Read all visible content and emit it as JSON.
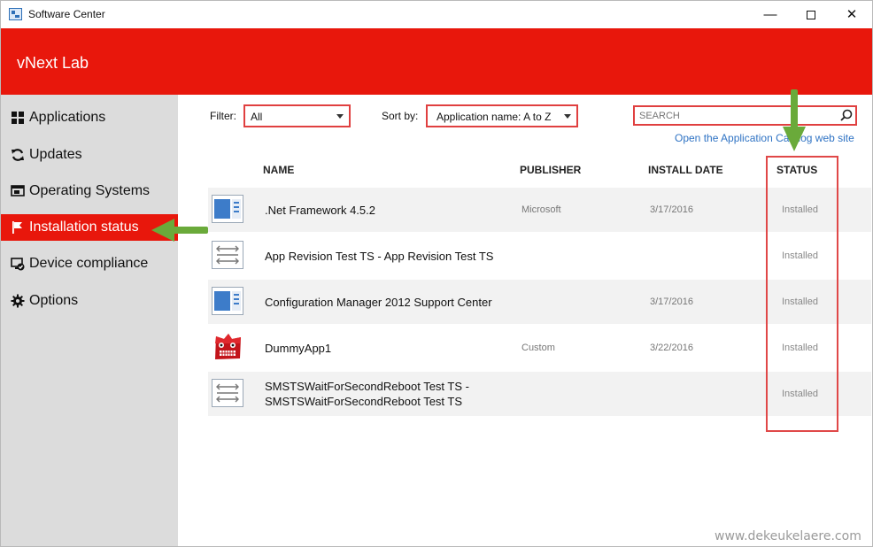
{
  "window": {
    "title": "Software Center"
  },
  "header": {
    "org_name": "vNext Lab"
  },
  "sidebar": {
    "items": [
      {
        "label": "Applications",
        "icon": "applications-grid-icon"
      },
      {
        "label": "Updates",
        "icon": "refresh-icon"
      },
      {
        "label": "Operating Systems",
        "icon": "os-window-icon"
      },
      {
        "label": "Installation status",
        "icon": "flag-icon",
        "active": true
      },
      {
        "label": "Device compliance",
        "icon": "compliance-icon"
      },
      {
        "label": "Options",
        "icon": "gear-icon"
      }
    ]
  },
  "toolbar": {
    "filter_label": "Filter:",
    "filter_value": "All",
    "sort_label": "Sort by:",
    "sort_value": "Application name: A to Z",
    "search_placeholder": "SEARCH",
    "catalog_link": "Open the Application Catalog web site"
  },
  "table": {
    "columns": [
      "NAME",
      "PUBLISHER",
      "INSTALL DATE",
      "STATUS"
    ],
    "rows": [
      {
        "name": ".Net Framework 4.5.2",
        "publisher": "Microsoft",
        "install_date": "3/17/2016",
        "status": "Installed",
        "icon": "application-icon"
      },
      {
        "name": "App Revision Test TS - App Revision Test TS",
        "publisher": "",
        "install_date": "",
        "status": "Installed",
        "icon": "task-sequence-icon"
      },
      {
        "name": "Configuration Manager 2012 Support Center",
        "publisher": "",
        "install_date": "3/17/2016",
        "status": "Installed",
        "icon": "application-icon"
      },
      {
        "name": "DummyApp1",
        "publisher": "Custom",
        "install_date": "3/22/2016",
        "status": "Installed",
        "icon": "red-monster-icon"
      },
      {
        "name": "SMSTSWaitForSecondReboot Test TS - SMSTSWaitForSecondReboot Test TS",
        "publisher": "",
        "install_date": "",
        "status": "Installed",
        "icon": "task-sequence-icon"
      }
    ]
  },
  "watermark": "www.dekeukelaere.com",
  "colors": {
    "brand_red": "#e8170c",
    "annotation_green": "#6aaa3a",
    "annotation_frame": "#e04848",
    "link_blue": "#2f73c4",
    "sidebar_bg": "#dcdcdc"
  }
}
